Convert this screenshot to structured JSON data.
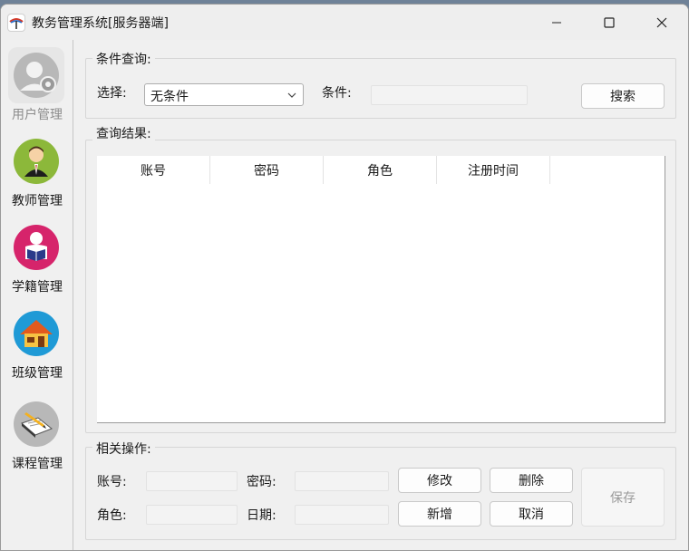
{
  "window": {
    "title": "教务管理系统[服务器端]",
    "icon": "app-logo-icon",
    "controls": [
      "minimize-icon",
      "maximize-icon",
      "close-icon"
    ]
  },
  "sidebar": {
    "items": [
      {
        "label": "用户管理",
        "icon": "user-settings-icon",
        "active": true
      },
      {
        "label": "教师管理",
        "icon": "teacher-icon"
      },
      {
        "label": "学籍管理",
        "icon": "student-reading-icon"
      },
      {
        "label": "班级管理",
        "icon": "house-icon"
      },
      {
        "label": "课程管理",
        "icon": "book-pen-icon"
      }
    ]
  },
  "query": {
    "title": "条件查询:",
    "select_label": "选择:",
    "select_value": "无条件",
    "condition_label": "条件:",
    "condition_value": "",
    "search_button": "搜索"
  },
  "results": {
    "title": "查询结果:",
    "columns": [
      "账号",
      "密码",
      "角色",
      "注册时间"
    ],
    "rows": []
  },
  "operations": {
    "title": "相关操作:",
    "account_label": "账号:",
    "account_value": "",
    "password_label": "密码:",
    "password_value": "",
    "role_label": "角色:",
    "role_value": "",
    "date_label": "日期:",
    "date_value": "",
    "modify_button": "修改",
    "delete_button": "删除",
    "add_button": "新增",
    "cancel_button": "取消",
    "save_button": "保存"
  },
  "colors": {
    "teacher_bg": "#8cb83a",
    "student_bg": "#d6246b",
    "class_bg": "#1f9ad6",
    "user_bg": "#b8b8b8"
  }
}
